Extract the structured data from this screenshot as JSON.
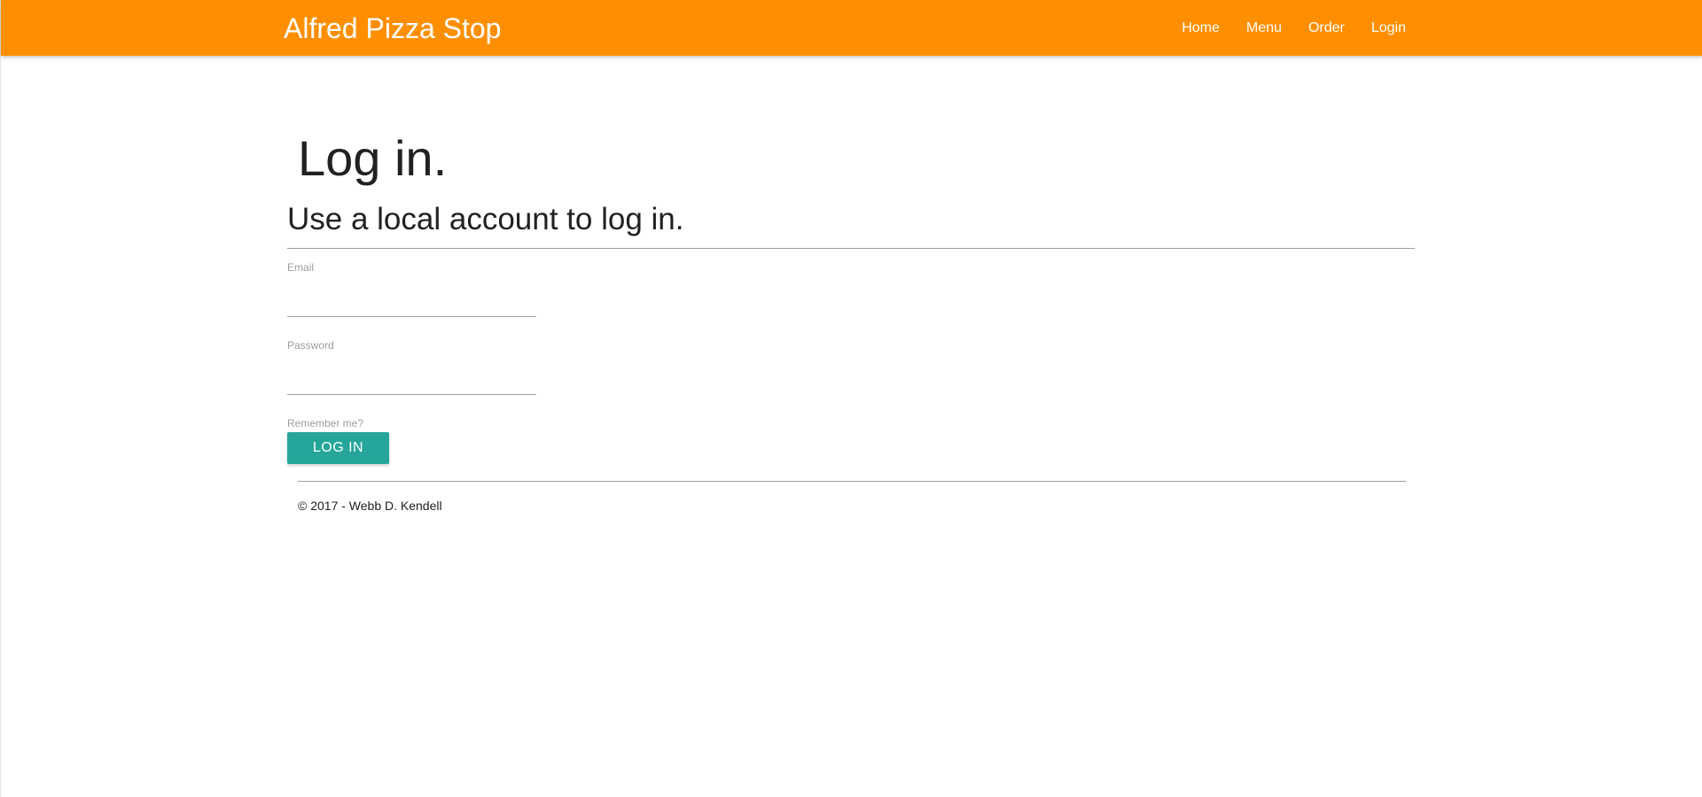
{
  "app": {
    "brand": "Alfred Pizza Stop",
    "theme_color": "#ff8f00",
    "button_color": "#26a69a"
  },
  "nav": {
    "items": [
      {
        "label": "Home"
      },
      {
        "label": "Menu"
      },
      {
        "label": "Order"
      },
      {
        "label": "Login"
      }
    ]
  },
  "login": {
    "title": "Log in.",
    "subtitle": "Use a local account to log in.",
    "email": {
      "label": "Email",
      "value": "",
      "placeholder": ""
    },
    "password": {
      "label": "Password",
      "value": "",
      "placeholder": ""
    },
    "remember_label": "Remember me?",
    "submit_label": "Log in"
  },
  "footer": {
    "text": "© 2017 - Webb D. Kendell"
  }
}
